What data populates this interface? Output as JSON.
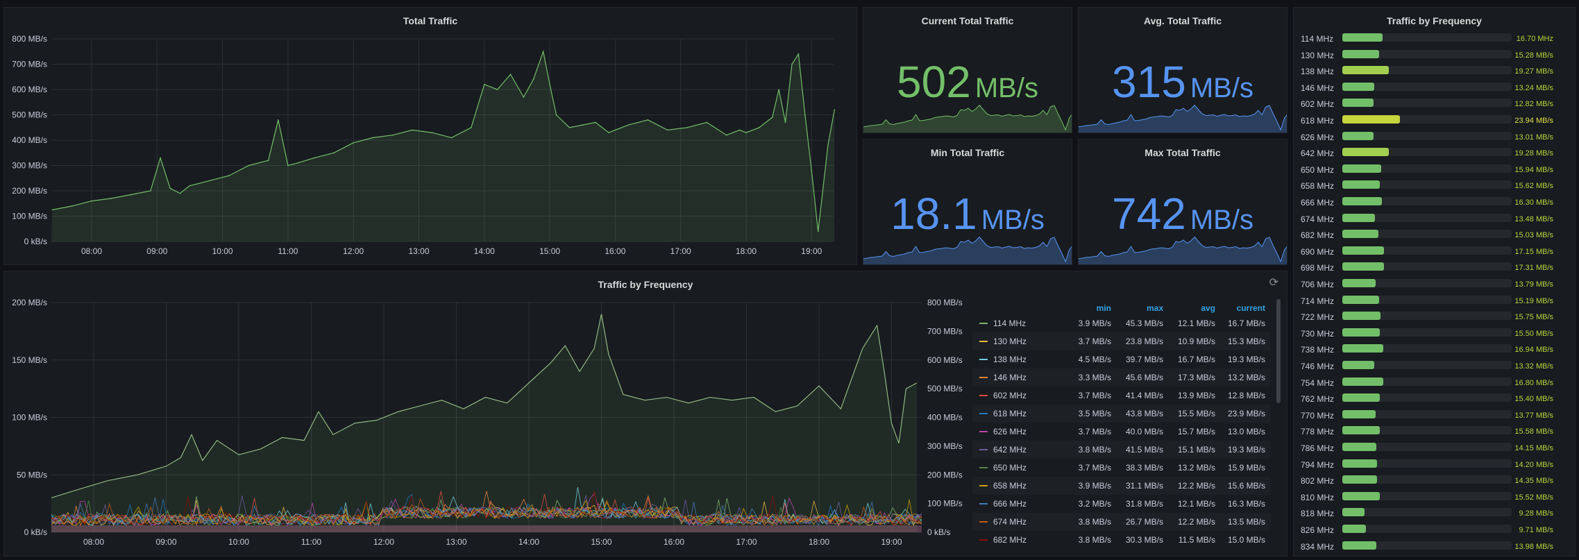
{
  "panels": {
    "total_traffic_title": "Total Traffic",
    "current_title": "Current Total Traffic",
    "avg_title": "Avg. Total Traffic",
    "min_title": "Min Total Traffic",
    "max_title": "Max Total Traffic",
    "freq_chart_title": "Traffic by Frequency",
    "bargauge_title": "Traffic by Frequency"
  },
  "stats": {
    "current": {
      "value": "502",
      "unit": "MB/s",
      "color": "#73bf69"
    },
    "avg": {
      "value": "315",
      "unit": "MB/s",
      "color": "#5794f2"
    },
    "min": {
      "value": "18.1",
      "unit": "MB/s",
      "color": "#5794f2"
    },
    "max": {
      "value": "742",
      "unit": "MB/s",
      "color": "#5794f2"
    }
  },
  "chart_data": [
    {
      "type": "area",
      "title": "Total Traffic",
      "x_ticks": [
        "08:00",
        "09:00",
        "10:00",
        "11:00",
        "12:00",
        "13:00",
        "14:00",
        "15:00",
        "16:00",
        "17:00",
        "18:00",
        "19:00"
      ],
      "y_ticks": [
        "0 kB/s",
        "100 MB/s",
        "200 MB/s",
        "300 MB/s",
        "400 MB/s",
        "500 MB/s",
        "600 MB/s",
        "700 MB/s",
        "800 MB/s"
      ],
      "ylim": [
        0,
        800
      ],
      "x_hours": [
        7.4,
        7.7,
        8.0,
        8.3,
        8.6,
        8.9,
        9.05,
        9.2,
        9.35,
        9.5,
        9.8,
        10.1,
        10.4,
        10.7,
        10.85,
        11.0,
        11.15,
        11.4,
        11.7,
        12.0,
        12.3,
        12.6,
        12.9,
        13.2,
        13.5,
        13.8,
        14.0,
        14.2,
        14.4,
        14.6,
        14.75,
        14.9,
        15.0,
        15.1,
        15.3,
        15.5,
        15.7,
        15.9,
        16.2,
        16.5,
        16.8,
        17.1,
        17.4,
        17.7,
        17.9,
        18.0,
        18.2,
        18.4,
        18.5,
        18.6,
        18.7,
        18.8,
        18.9,
        19.0,
        19.1,
        19.25,
        19.35
      ],
      "values": [
        125,
        140,
        160,
        170,
        185,
        200,
        330,
        210,
        190,
        220,
        240,
        260,
        300,
        320,
        480,
        300,
        310,
        330,
        350,
        390,
        410,
        420,
        440,
        430,
        410,
        450,
        620,
        600,
        660,
        570,
        640,
        750,
        620,
        500,
        450,
        460,
        470,
        430,
        460,
        480,
        440,
        450,
        470,
        420,
        440,
        430,
        450,
        490,
        600,
        470,
        700,
        740,
        500,
        280,
        40,
        380,
        520
      ],
      "color": "#73bf69"
    },
    {
      "type": "line",
      "title": "Traffic by Frequency",
      "x_ticks": [
        "08:00",
        "09:00",
        "10:00",
        "11:00",
        "12:00",
        "13:00",
        "14:00",
        "15:00",
        "16:00",
        "17:00",
        "18:00",
        "19:00"
      ],
      "y_left_ticks": [
        "0 kB/s",
        "50 MB/s",
        "100 MB/s",
        "150 MB/s",
        "200 MB/s"
      ],
      "y_right_ticks": [
        "0 kB/s",
        "100 MB/s",
        "200 MB/s",
        "300 MB/s",
        "400 MB/s",
        "500 MB/s",
        "600 MB/s",
        "700 MB/s",
        "800 MB/s"
      ],
      "ylim_left": [
        0,
        200
      ],
      "ylim_right": [
        0,
        800
      ],
      "total_series": {
        "x_hours": [
          7.4,
          7.8,
          8.2,
          8.6,
          9.0,
          9.2,
          9.35,
          9.5,
          9.7,
          10.0,
          10.3,
          10.6,
          10.9,
          11.1,
          11.3,
          11.6,
          11.9,
          12.2,
          12.5,
          12.8,
          13.1,
          13.4,
          13.7,
          14.0,
          14.3,
          14.5,
          14.7,
          14.9,
          15.0,
          15.1,
          15.3,
          15.6,
          15.9,
          16.2,
          16.5,
          16.8,
          17.1,
          17.4,
          17.7,
          18.0,
          18.3,
          18.6,
          18.8,
          18.9,
          19.0,
          19.1,
          19.2,
          19.35
        ],
        "values": [
          120,
          150,
          180,
          200,
          230,
          260,
          340,
          250,
          320,
          270,
          290,
          330,
          320,
          420,
          340,
          380,
          390,
          420,
          440,
          460,
          430,
          470,
          450,
          520,
          590,
          650,
          560,
          640,
          760,
          620,
          480,
          460,
          470,
          450,
          470,
          460,
          470,
          420,
          440,
          510,
          430,
          640,
          720,
          560,
          380,
          310,
          500,
          520
        ]
      },
      "legend_headers": [
        "min",
        "max",
        "avg",
        "current"
      ],
      "series": [
        {
          "name": "114 MHz",
          "color": "#7eb26d",
          "min": "3.9 MB/s",
          "max": "45.3 MB/s",
          "avg": "12.1 MB/s",
          "current": "16.7 MB/s"
        },
        {
          "name": "130 MHz",
          "color": "#eab839",
          "min": "3.7 MB/s",
          "max": "23.8 MB/s",
          "avg": "10.9 MB/s",
          "current": "15.3 MB/s"
        },
        {
          "name": "138 MHz",
          "color": "#6ed0e0",
          "min": "4.5 MB/s",
          "max": "39.7 MB/s",
          "avg": "16.7 MB/s",
          "current": "19.3 MB/s"
        },
        {
          "name": "146 MHz",
          "color": "#ef843c",
          "min": "3.3 MB/s",
          "max": "45.6 MB/s",
          "avg": "17.3 MB/s",
          "current": "13.2 MB/s"
        },
        {
          "name": "602 MHz",
          "color": "#e24d42",
          "min": "3.7 MB/s",
          "max": "41.4 MB/s",
          "avg": "13.9 MB/s",
          "current": "12.8 MB/s"
        },
        {
          "name": "618 MHz",
          "color": "#1f78c1",
          "min": "3.5 MB/s",
          "max": "43.8 MB/s",
          "avg": "15.5 MB/s",
          "current": "23.9 MB/s"
        },
        {
          "name": "626 MHz",
          "color": "#ba43a9",
          "min": "3.7 MB/s",
          "max": "40.0 MB/s",
          "avg": "15.7 MB/s",
          "current": "13.0 MB/s"
        },
        {
          "name": "642 MHz",
          "color": "#705da0",
          "min": "3.8 MB/s",
          "max": "41.5 MB/s",
          "avg": "15.1 MB/s",
          "current": "19.3 MB/s"
        },
        {
          "name": "650 MHz",
          "color": "#508642",
          "min": "3.7 MB/s",
          "max": "38.3 MB/s",
          "avg": "13.2 MB/s",
          "current": "15.9 MB/s"
        },
        {
          "name": "658 MHz",
          "color": "#cca300",
          "min": "3.9 MB/s",
          "max": "31.1 MB/s",
          "avg": "12.2 MB/s",
          "current": "15.6 MB/s"
        },
        {
          "name": "666 MHz",
          "color": "#447ebc",
          "min": "3.2 MB/s",
          "max": "31.8 MB/s",
          "avg": "12.1 MB/s",
          "current": "16.3 MB/s"
        },
        {
          "name": "674 MHz",
          "color": "#c15c17",
          "min": "3.8 MB/s",
          "max": "26.7 MB/s",
          "avg": "12.2 MB/s",
          "current": "13.5 MB/s"
        },
        {
          "name": "682 MHz",
          "color": "#890f02",
          "min": "3.8 MB/s",
          "max": "30.3 MB/s",
          "avg": "11.5 MB/s",
          "current": "15.0 MB/s"
        }
      ]
    },
    {
      "type": "bar",
      "title": "Traffic by Frequency",
      "max": 70,
      "categories": [
        "114 MHz",
        "130 MHz",
        "138 MHz",
        "146 MHz",
        "602 MHz",
        "618 MHz",
        "626 MHz",
        "642 MHz",
        "650 MHz",
        "658 MHz",
        "666 MHz",
        "674 MHz",
        "682 MHz",
        "690 MHz",
        "698 MHz",
        "706 MHz",
        "714 MHz",
        "722 MHz",
        "730 MHz",
        "738 MHz",
        "746 MHz",
        "754 MHz",
        "762 MHz",
        "770 MHz",
        "778 MHz",
        "786 MHz",
        "794 MHz",
        "802 MHz",
        "810 MHz",
        "818 MHz",
        "826 MHz",
        "834 MHz"
      ],
      "values": [
        16.7,
        15.28,
        19.27,
        13.24,
        12.82,
        23.94,
        13.01,
        19.28,
        15.94,
        15.62,
        16.3,
        13.48,
        15.03,
        17.15,
        17.31,
        13.79,
        15.19,
        15.75,
        15.5,
        16.94,
        13.32,
        16.8,
        15.4,
        13.77,
        15.58,
        14.15,
        14.2,
        14.35,
        15.52,
        9.28,
        9.71,
        13.98
      ],
      "labels": [
        "16.70 MHz",
        "15.28 MB/s",
        "19.27 MB/s",
        "13.24 MB/s",
        "12.82 MB/s",
        "23.94 MB/s",
        "13.01 MB/s",
        "19.28 MB/s",
        "15.94 MB/s",
        "15.62 MB/s",
        "16.30 MB/s",
        "13.48 MB/s",
        "15.03 MB/s",
        "17.15 MB/s",
        "17.31 MB/s",
        "13.79 MB/s",
        "15.19 MB/s",
        "15.75 MB/s",
        "15.50 MB/s",
        "16.94 MB/s",
        "13.32 MB/s",
        "16.80 MB/s",
        "15.40 MB/s",
        "13.77 MB/s",
        "15.58 MB/s",
        "14.15 MB/s",
        "14.20 MB/s",
        "14.35 MB/s",
        "15.52 MB/s",
        "9.28 MB/s",
        "9.71 MB/s",
        "13.98 MB/s"
      ]
    }
  ]
}
